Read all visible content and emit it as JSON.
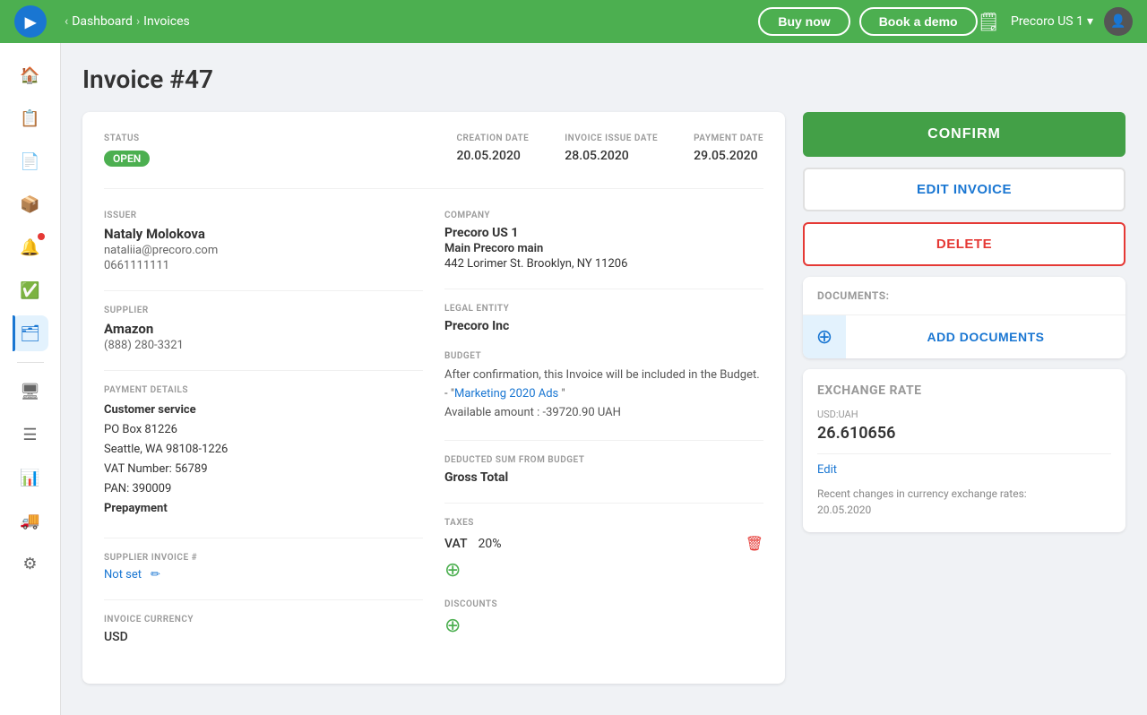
{
  "navbar": {
    "breadcrumb": {
      "dashboard": "Dashboard",
      "invoices": "Invoices"
    },
    "buy_now": "Buy now",
    "book_demo": "Book a demo",
    "company": "Precoro US 1"
  },
  "page": {
    "title": "Invoice #47"
  },
  "invoice": {
    "status_label": "STATUS",
    "status_value": "OPEN",
    "creation_date_label": "CREATION DATE",
    "creation_date": "20.05.2020",
    "issue_date_label": "INVOICE ISSUE DATE",
    "issue_date": "28.05.2020",
    "payment_date_label": "PAYMENT DATE",
    "payment_date": "29.05.2020",
    "issuer_label": "ISSUER",
    "issuer_name": "Nataly Molokova",
    "issuer_email": "nataliia@precoro.com",
    "issuer_phone": "0661111111",
    "supplier_label": "SUPPLIER",
    "supplier_name": "Amazon",
    "supplier_phone": "(888) 280-3321",
    "company_label": "COMPANY",
    "company_name": "Precoro US 1",
    "company_main": "Main Precoro main",
    "company_address": "442 Lorimer St. Brooklyn, NY 11206",
    "legal_entity_label": "LEGAL ENTITY",
    "legal_entity": "Precoro Inc",
    "budget_label": "BUDGET",
    "budget_text_pre": "After confirmation, this Invoice will be included in the Budget. - \"",
    "budget_link": "Marketing 2020 Ads",
    "budget_text_post": " \"",
    "budget_available": "Available amount : -39720.90 UAH",
    "deducted_label": "DEDUCTED SUM FROM BUDGET",
    "deducted_value": "Gross Total",
    "payment_details_label": "PAYMENT DETAILS",
    "payment_line1": "Customer service",
    "payment_line2": "PO Box 81226",
    "payment_line3": "Seattle, WA 98108-1226",
    "payment_line4": "VAT Number: 56789",
    "payment_line5": "PAN: 390009",
    "payment_line6": "Prepayment",
    "supplier_invoice_label": "SUPPLIER INVOICE #",
    "supplier_invoice_value": "Not set",
    "invoice_currency_label": "INVOICE CURRENCY",
    "invoice_currency": "USD",
    "taxes_label": "TAXES",
    "tax_name": "VAT",
    "tax_percent": "20%",
    "discounts_label": "DISCOUNTS"
  },
  "sidebar": {
    "items": [
      {
        "icon": "🏠",
        "name": "home"
      },
      {
        "icon": "📋",
        "name": "purchase-requests"
      },
      {
        "icon": "📄",
        "name": "purchase-orders"
      },
      {
        "icon": "📦",
        "name": "receiving"
      },
      {
        "icon": "🔔",
        "name": "notifications"
      },
      {
        "icon": "✅",
        "name": "approvals"
      },
      {
        "icon": "🗂",
        "name": "invoices-nav"
      },
      {
        "icon": "🖥",
        "name": "reports"
      },
      {
        "icon": "☰",
        "name": "menu"
      },
      {
        "icon": "📊",
        "name": "analytics"
      },
      {
        "icon": "🚚",
        "name": "suppliers-nav"
      },
      {
        "icon": "⚙",
        "name": "settings"
      }
    ]
  },
  "right_panel": {
    "confirm_label": "CONFIRM",
    "edit_invoice_label": "EDIT INVOICE",
    "delete_label": "DELETE",
    "documents_label": "DOCUMENTS:",
    "add_documents_label": "ADD DOCUMENTS",
    "exchange_rate_title": "EXCHANGE RATE",
    "exchange_pair": "USD:UAH",
    "exchange_rate_value": "26.610656",
    "edit_link": "Edit",
    "exchange_note": "Recent changes in currency exchange rates:",
    "exchange_note_date": "20.05.2020"
  }
}
